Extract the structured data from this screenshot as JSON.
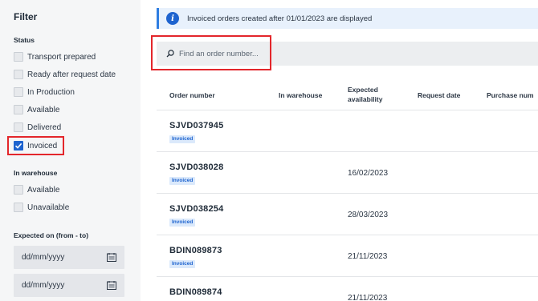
{
  "sidebar": {
    "title": "Filter",
    "status": {
      "title": "Status",
      "items": [
        {
          "label": "Transport prepared",
          "checked": false
        },
        {
          "label": "Ready after request date",
          "checked": false
        },
        {
          "label": "In Production",
          "checked": false
        },
        {
          "label": "Available",
          "checked": false
        },
        {
          "label": "Delivered",
          "checked": false
        },
        {
          "label": "Invoiced",
          "checked": true
        }
      ]
    },
    "warehouse": {
      "title": "In warehouse",
      "items": [
        {
          "label": "Available",
          "checked": false
        },
        {
          "label": "Unavailable",
          "checked": false
        }
      ]
    },
    "expected": {
      "title": "Expected on (from - to)",
      "from_placeholder": "dd/mm/yyyy",
      "to_placeholder": "dd/mm/yyyy"
    }
  },
  "banner": {
    "icon": "info-icon",
    "text": "Invoiced orders created after 01/01/2023 are displayed"
  },
  "search": {
    "icon": "search-icon",
    "placeholder": "Find an order number..."
  },
  "table": {
    "columns": [
      "Order number",
      "In warehouse",
      "Expected availability",
      "Request date",
      "Purchase num"
    ],
    "rows": [
      {
        "order_number": "SJVD037945",
        "badge": "Invoiced",
        "expected": ""
      },
      {
        "order_number": "SJVD038028",
        "badge": "Invoiced",
        "expected": "16/02/2023"
      },
      {
        "order_number": "SJVD038254",
        "badge": "Invoiced",
        "expected": "28/03/2023"
      },
      {
        "order_number": "BDIN089873",
        "badge": "Invoiced",
        "expected": "21/11/2023"
      },
      {
        "order_number": "BDIN089874",
        "badge": "",
        "expected": "21/11/2023"
      }
    ]
  },
  "colors": {
    "accent": "#1d63cf",
    "highlight": "#e3262b",
    "banner_bg": "#e8f1fc"
  }
}
